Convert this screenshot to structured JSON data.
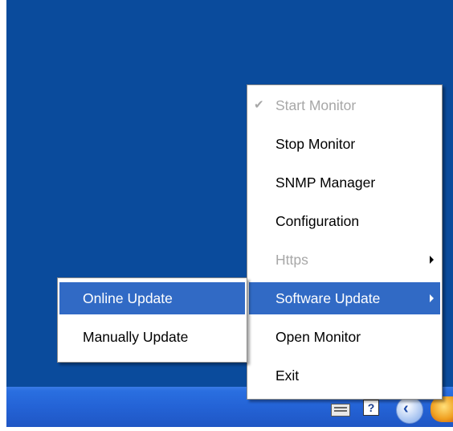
{
  "main_menu": {
    "items": [
      {
        "label": "Start Monitor",
        "checked": true,
        "disabled": true
      },
      {
        "label": "Stop Monitor"
      },
      {
        "label": "SNMP Manager"
      },
      {
        "label": "Configuration"
      },
      {
        "label": "Https",
        "disabled": true,
        "submenu": true
      },
      {
        "label": "Software Update",
        "highlighted": true,
        "submenu": true
      },
      {
        "label": "Open Monitor"
      },
      {
        "label": "Exit"
      }
    ]
  },
  "sub_menu": {
    "items": [
      {
        "label": "Online Update",
        "highlighted": true
      },
      {
        "label": "Manually Update"
      }
    ]
  },
  "tray": {
    "icons": [
      "keyboard-icon",
      "help-icon",
      "back-arrow-icon",
      "app-icon"
    ],
    "help_glyph": "?",
    "back_glyph": "‹"
  },
  "colors": {
    "desktop": "#0a4b9c",
    "highlight": "#316ac5",
    "disabled_text": "#a7a7a7"
  }
}
